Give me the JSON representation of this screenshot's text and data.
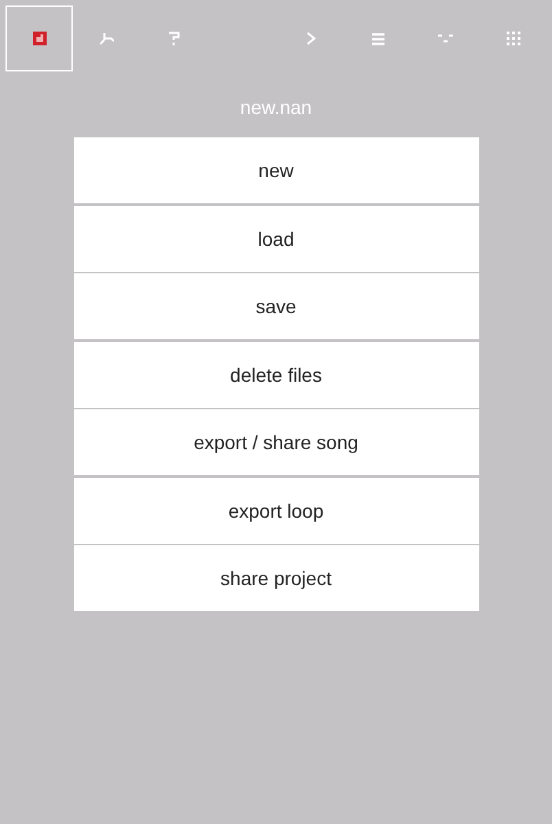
{
  "toolbar_left": [
    {
      "kind": "file",
      "selected": true
    },
    {
      "kind": "wrench",
      "selected": false
    },
    {
      "kind": "help",
      "selected": false
    }
  ],
  "toolbar_right": [
    {
      "kind": "play",
      "selected": false
    },
    {
      "kind": "list",
      "selected": false
    },
    {
      "kind": "pattern",
      "selected": false
    },
    {
      "kind": "grid",
      "selected": false
    }
  ],
  "title": "new.nan",
  "menu": [
    "new",
    "load",
    "save",
    "delete files",
    "export / share song",
    "export loop",
    "share project"
  ]
}
